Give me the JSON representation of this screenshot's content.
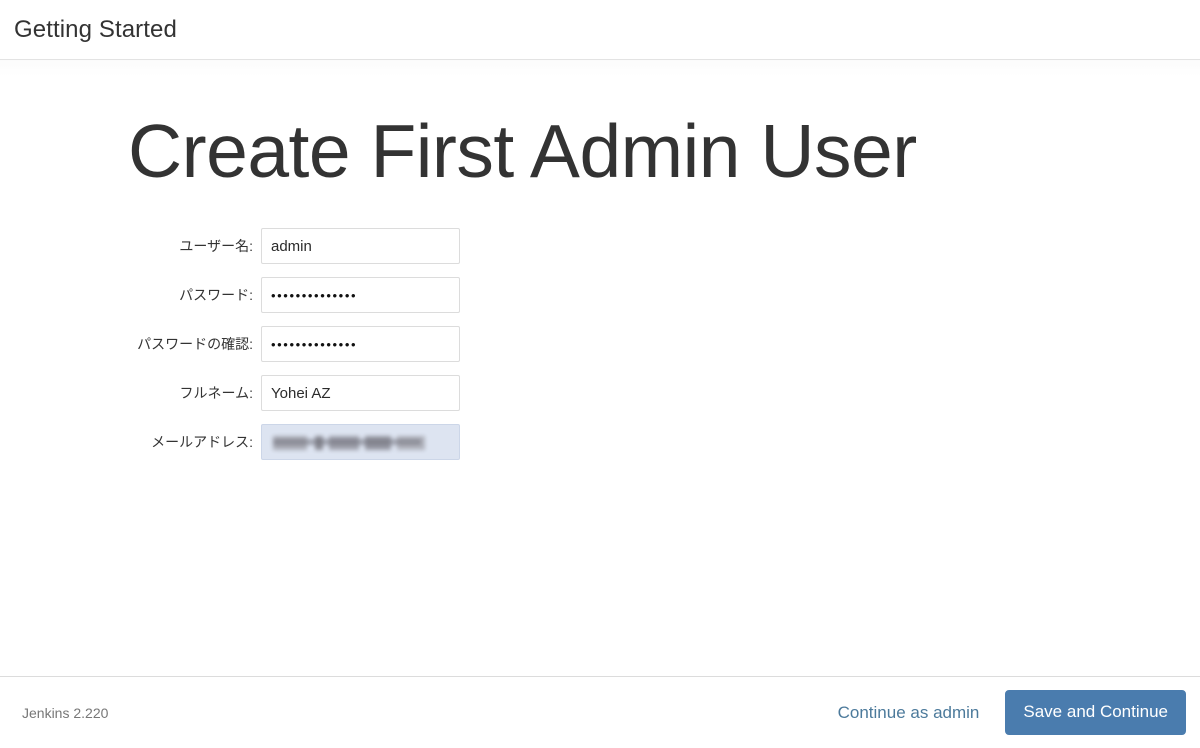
{
  "header": {
    "title": "Getting Started"
  },
  "setup": {
    "title": "Create First Admin User",
    "form": {
      "fields": [
        {
          "name": "username",
          "label": "ユーザー名:",
          "type": "text",
          "value": "admin",
          "placeholder": ""
        },
        {
          "name": "password1",
          "label": "パスワード:",
          "type": "password",
          "value": "••••••••••••••",
          "placeholder": ""
        },
        {
          "name": "password2",
          "label": "パスワードの確認:",
          "type": "password",
          "value": "••••••••••••••",
          "placeholder": ""
        },
        {
          "name": "fullname",
          "label": "フルネーム:",
          "type": "text",
          "value": "Yohei AZ",
          "placeholder": ""
        },
        {
          "name": "email",
          "label": "メールアドレス:",
          "type": "email",
          "value": "",
          "redacted": true,
          "focused": true,
          "placeholder": ""
        }
      ]
    }
  },
  "footer": {
    "version": "Jenkins 2.220",
    "continue_as_label": "Continue as admin",
    "save_label": "Save and Continue"
  },
  "colors": {
    "primary_button_bg": "#4a7cae",
    "link": "#4c7a9b",
    "text": "#333333",
    "muted_text": "#777777",
    "input_border": "#dcdcdc",
    "focused_field_bg": "#dde4f1",
    "divider": "#dcdcdc"
  }
}
